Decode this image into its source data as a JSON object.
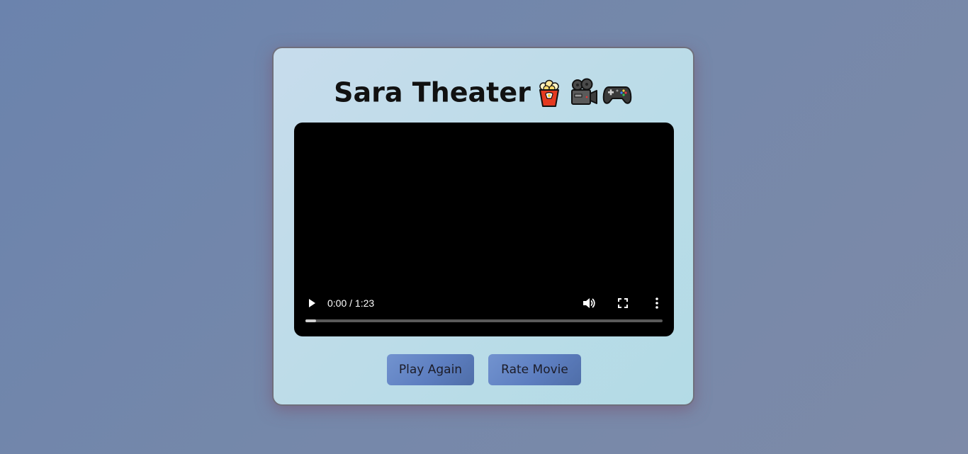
{
  "header": {
    "title": "Sara Theater",
    "emojis": [
      "popcorn-icon",
      "movie-camera-icon",
      "game-controller-icon"
    ]
  },
  "video": {
    "time": "0:00 / 1:23",
    "progress_fraction": 0.03,
    "controls": [
      "play-icon",
      "volume-icon",
      "fullscreen-icon",
      "more-options-icon"
    ]
  },
  "actions": {
    "play_again": "Play Again",
    "rate_movie": "Rate Movie"
  },
  "colors": {
    "background": "#7388ab",
    "card": "#bcdce8",
    "button": "#6483c2",
    "player": "#000000"
  }
}
